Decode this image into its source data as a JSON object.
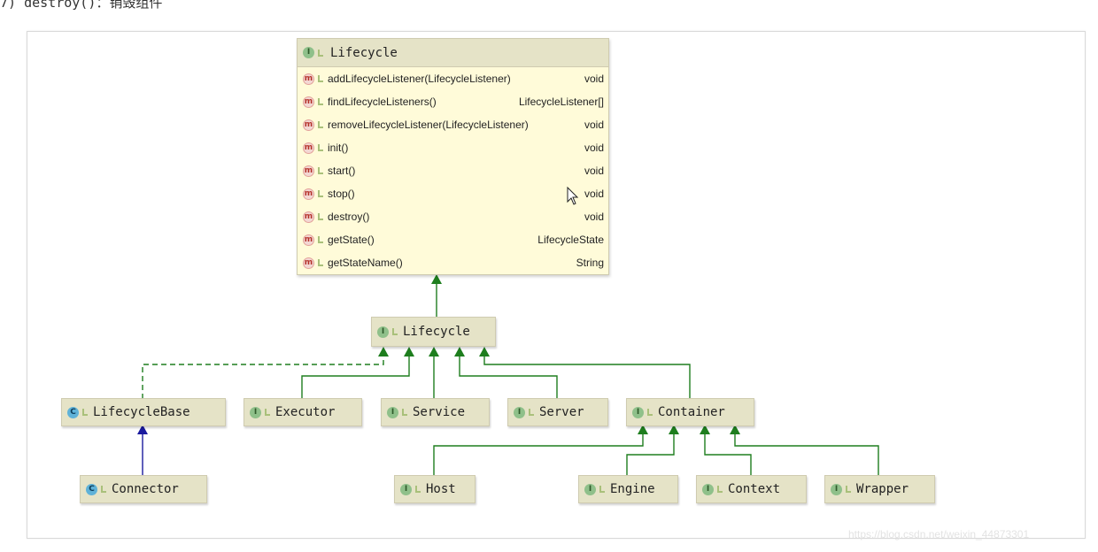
{
  "top_text": "7) destroy()：销毁组件",
  "interface_box": {
    "title": "Lifecycle",
    "icon": "I",
    "methods": [
      {
        "name": "addLifecycleListener(LifecycleListener)",
        "type": "void"
      },
      {
        "name": "findLifecycleListeners()",
        "type": "LifecycleListener[]"
      },
      {
        "name": "removeLifecycleListener(LifecycleListener)",
        "type": "void"
      },
      {
        "name": "init()",
        "type": "void"
      },
      {
        "name": "start()",
        "type": "void"
      },
      {
        "name": "stop()",
        "type": "void"
      },
      {
        "name": "destroy()",
        "type": "void"
      },
      {
        "name": "getState()",
        "type": "LifecycleState"
      },
      {
        "name": "getStateName()",
        "type": "String"
      }
    ]
  },
  "nodes": {
    "lifecycle": "Lifecycle",
    "lifecycle_base": "LifecycleBase",
    "executor": "Executor",
    "service": "Service",
    "server": "Server",
    "container": "Container",
    "connector": "Connector",
    "host": "Host",
    "engine": "Engine",
    "context": "Context",
    "wrapper": "Wrapper"
  },
  "icons": {
    "interface": "I",
    "class": "C",
    "method": "m"
  },
  "colors": {
    "box_fill": "#e5e3c7",
    "member_fill": "#fffbd9",
    "extends_line": "#1e7e1e",
    "class_line": "#1a1a9e"
  },
  "watermark": "https://blog.csdn.net/weixin_44873301"
}
